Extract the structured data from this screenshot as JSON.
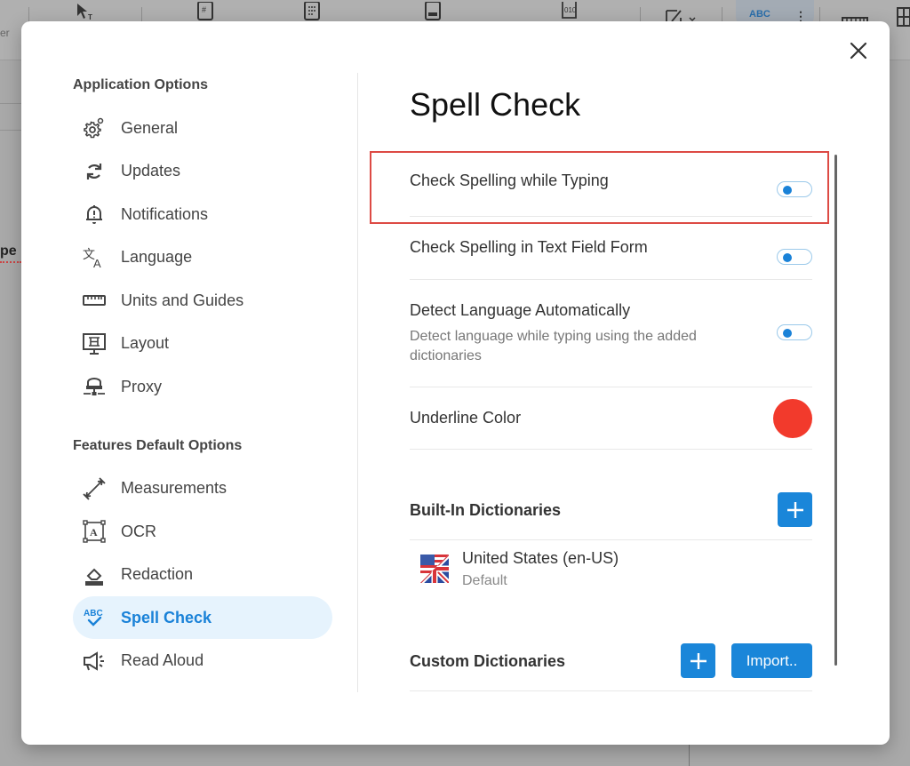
{
  "background": {
    "toolbar_icons": [
      "select-text-tool-icon",
      "page-number-icon",
      "calculator-icon",
      "page-footer-icon",
      "bates-number-icon",
      "edit-icon",
      "spell-check-icon",
      "more-options-icon",
      "ruler-icon",
      "grid-icon"
    ],
    "spell_check_tool_label": "ABC",
    "left_edge_text": "er",
    "document_word_fragment": "pe"
  },
  "dialog": {
    "close_label": "×",
    "sidebar": {
      "application_section_title": "Application Options",
      "application_items": [
        {
          "label": "General",
          "icon": "gear-icon"
        },
        {
          "label": "Updates",
          "icon": "refresh-icon"
        },
        {
          "label": "Notifications",
          "icon": "bell-alert-icon"
        },
        {
          "label": "Language",
          "icon": "translate-icon"
        },
        {
          "label": "Units and Guides",
          "icon": "ruler-icon"
        },
        {
          "label": "Layout",
          "icon": "monitor-layout-icon"
        },
        {
          "label": "Proxy",
          "icon": "network-proxy-icon"
        }
      ],
      "features_section_title": "Features Default Options",
      "feature_items": [
        {
          "label": "Measurements",
          "icon": "measure-arrow-icon"
        },
        {
          "label": "OCR",
          "icon": "ocr-icon"
        },
        {
          "label": "Redaction",
          "icon": "eraser-icon"
        },
        {
          "label": "Spell Check",
          "icon": "spell-check-icon",
          "active": true
        },
        {
          "label": "Read Aloud",
          "icon": "megaphone-icon"
        }
      ]
    },
    "main": {
      "title": "Spell Check",
      "settings": [
        {
          "title": "Check Spelling while Typing",
          "enabled": true
        },
        {
          "title": "Check Spelling in Text Field Form",
          "enabled": true
        },
        {
          "title": "Detect Language Automatically",
          "description": "Detect language while typing using the added dictionaries",
          "enabled": true
        }
      ],
      "underline_color": {
        "title": "Underline Color",
        "value": "#f23a2c"
      },
      "built_in_dictionaries": {
        "title": "Built-In Dictionaries",
        "add_label": "+",
        "items": [
          {
            "name": "United States (en-US)",
            "subtitle": "Default",
            "icon": "us-uk-flag-icon"
          }
        ]
      },
      "custom_dictionaries": {
        "title": "Custom Dictionaries",
        "add_label": "+",
        "import_label": "Import.."
      }
    },
    "accent_color": "#1a82d8",
    "highlight_color": "#dd4a44"
  }
}
